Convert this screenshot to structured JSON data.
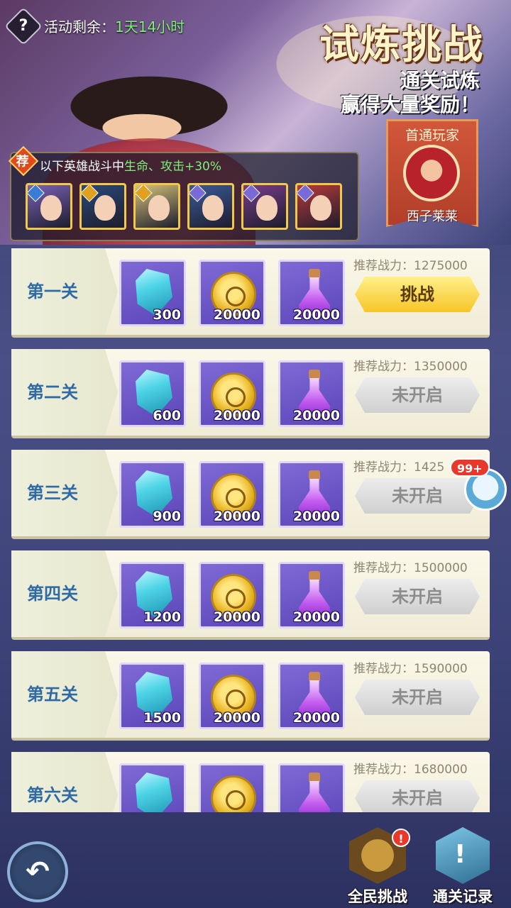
{
  "header": {
    "timer_label": "活动剩余：",
    "timer_value": "1天14小时",
    "title": "试炼挑战",
    "subtitle_line1": "通关试炼",
    "subtitle_line2": "赢得大量奖励！"
  },
  "first_clear": {
    "title": "首通玩家",
    "player_name": "西子莱莱"
  },
  "recommend": {
    "tag": "荐",
    "text_prefix": "以下英雄战斗中",
    "text_highlight": "生命、攻击+30%",
    "heroes": [
      {
        "badge_color": "#3a7bd5",
        "bg": "#7b63b8"
      },
      {
        "badge_color": "#e0a020",
        "bg": "#2a4a7a"
      },
      {
        "badge_color": "#e0a020",
        "bg": "#d6c27a"
      },
      {
        "badge_color": "#7a6ad8",
        "bg": "#3c5a9a"
      },
      {
        "badge_color": "#7a6ad8",
        "bg": "#7a3c8a"
      },
      {
        "badge_color": "#7a6ad8",
        "bg": "#b83a3a"
      }
    ]
  },
  "stages": [
    {
      "name": "第一关",
      "crystal": "300",
      "gold": "20000",
      "potion": "20000",
      "power_label": "推荐战力：",
      "power": "1275000",
      "button": "挑战",
      "active": true
    },
    {
      "name": "第二关",
      "crystal": "600",
      "gold": "20000",
      "potion": "20000",
      "power_label": "推荐战力：",
      "power": "1350000",
      "button": "未开启",
      "active": false
    },
    {
      "name": "第三关",
      "crystal": "900",
      "gold": "20000",
      "potion": "20000",
      "power_label": "推荐战力：",
      "power": "1425",
      "button": "未开启",
      "active": false
    },
    {
      "name": "第四关",
      "crystal": "1200",
      "gold": "20000",
      "potion": "20000",
      "power_label": "推荐战力：",
      "power": "1500000",
      "button": "未开启",
      "active": false
    },
    {
      "name": "第五关",
      "crystal": "1500",
      "gold": "20000",
      "potion": "20000",
      "power_label": "推荐战力：",
      "power": "1590000",
      "button": "未开启",
      "active": false
    },
    {
      "name": "第六关",
      "crystal": "",
      "gold": "",
      "potion": "",
      "power_label": "推荐战力：",
      "power": "1680000",
      "button": "未开启",
      "active": false
    }
  ],
  "chat": {
    "badge": "99+"
  },
  "bottom": {
    "all_challenge_label": "全民挑战",
    "record_label": "通关记录",
    "alert": "!",
    "back_icon": "back-arrow-icon"
  },
  "colors": {
    "stage_name": "#2f6aa7",
    "active_button": "#f7c528",
    "locked_button": "#cfcfcf",
    "highlight_green": "#7ef07a"
  }
}
